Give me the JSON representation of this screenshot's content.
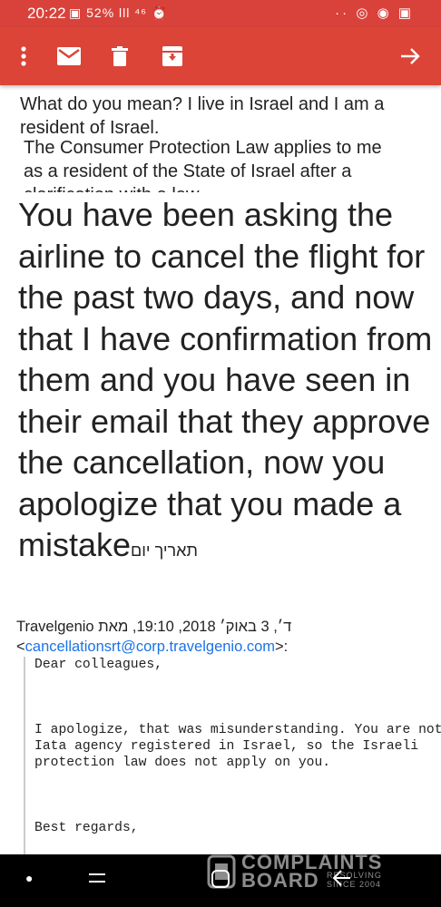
{
  "status": {
    "time": "20:22",
    "battery": "52%",
    "left_icons": "▣ 52% lll ⁴⁶ ⏰",
    "right_icons": "·· ◎ ◉ ▣"
  },
  "toolbar": {
    "icons": [
      "more-vert-icon",
      "mail-icon",
      "delete-icon",
      "archive-icon",
      "arrow-forward-icon"
    ]
  },
  "email": {
    "quoted_line1": "What do you mean? I live in Israel and I am a resident of Israel.",
    "quoted_line2": "The Consumer Protection Law applies to me as a resident of the State of Israel after a clarification with a law",
    "body": "You have been asking the airline to cancel the flight for the past two days, and now that I have confirmation from them and you have seen in their email that they approve the cancellation, now you apologize that you made a mistake",
    "hebrew_tail": "תאריך יום",
    "header_line": "ד׳, 3 באוק׳ 2018, 19:10, מאת Travelgenio",
    "sender_email": "cancellationsrt@corp.travelgenio.com",
    "quote_greeting": "Dear colleagues,",
    "quote_body": "I apologize, that was misunderstanding. You are not Iata agency registered in Israel, so the Israeli protection law does not apply on you.",
    "quote_closing": "Best regards,"
  },
  "watermark": {
    "line1": "COMPLAINTS",
    "line2": "BOARD",
    "tagline": "RESOLVING SINCE 2004"
  }
}
